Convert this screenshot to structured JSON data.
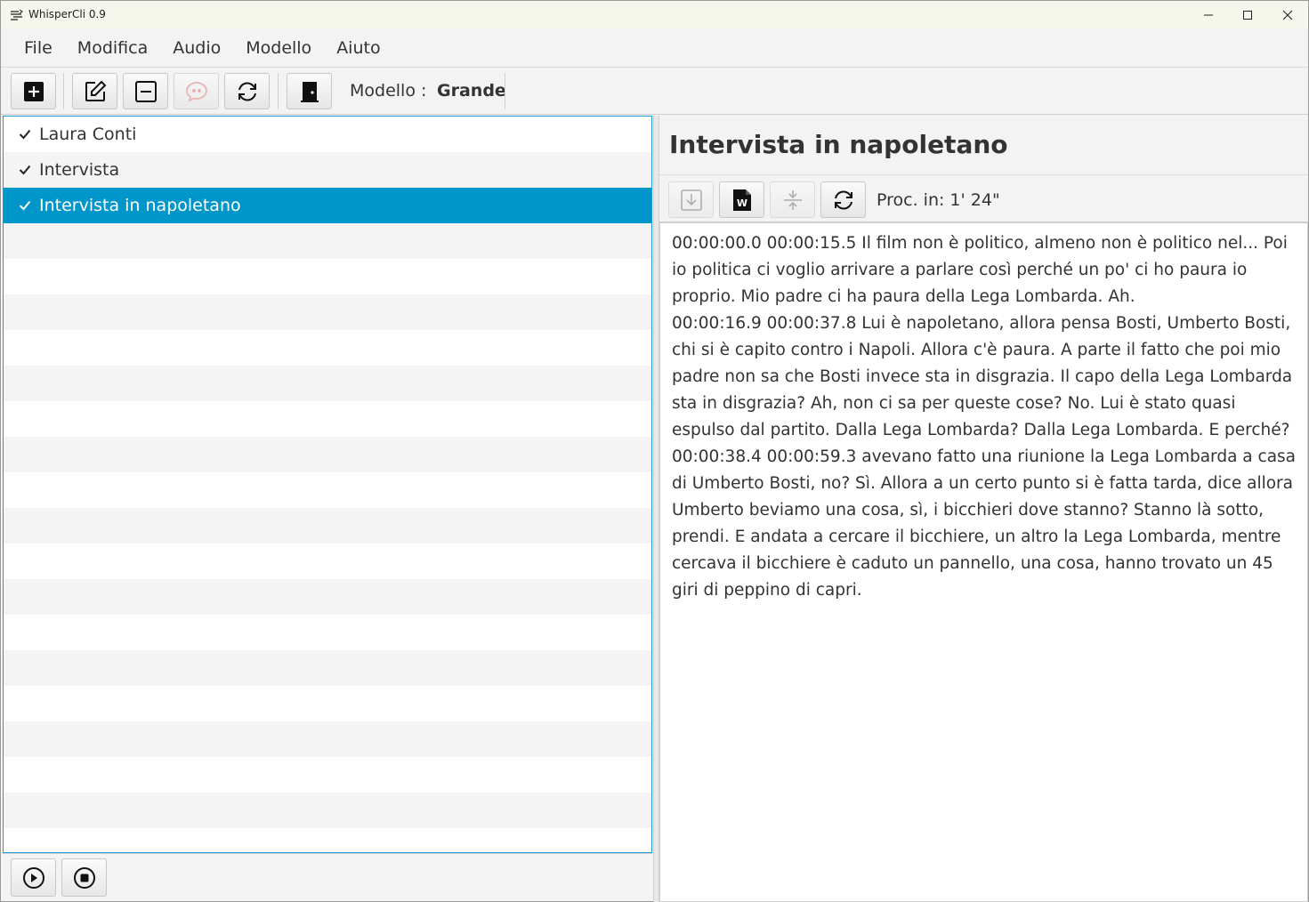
{
  "app": {
    "title": "WhisperCli 0.9"
  },
  "window_controls": [
    "minimize-icon",
    "maximize-icon",
    "close-icon"
  ],
  "menu": [
    {
      "label": "File"
    },
    {
      "label": "Modifica"
    },
    {
      "label": "Audio"
    },
    {
      "label": "Modello"
    },
    {
      "label": "Aiuto"
    }
  ],
  "toolbar": {
    "buttons": [
      "add-icon",
      "edit-icon",
      "remove-icon",
      "speech-icon",
      "refresh-icon",
      "exit-door-icon"
    ],
    "model_label": "Modello :",
    "model_value": "Grande"
  },
  "list": {
    "items": [
      {
        "label": "Laura Conti",
        "checked": true,
        "selected": false
      },
      {
        "label": "Intervista",
        "checked": true,
        "selected": false
      },
      {
        "label": "Intervista in napoletano",
        "checked": true,
        "selected": true
      }
    ]
  },
  "player": {
    "buttons": [
      "play-icon",
      "stop-icon"
    ]
  },
  "detail": {
    "title": "Intervista in napoletano",
    "buttons": [
      "download-icon",
      "word-doc-icon",
      "compress-icon",
      "refresh-icon"
    ],
    "proc_label": "Proc. in: 1' 24\"",
    "transcript": "00:00:00.0 00:00:15.5 Il film non è politico, almeno non è politico nel... Poi io politica ci voglio arrivare a parlare così perché un po' ci ho paura io proprio. Mio padre ci ha paura della Lega Lombarda. Ah.\n00:00:16.9 00:00:37.8 Lui è napoletano, allora pensa Bosti, Umberto Bosti, chi si è capito contro i Napoli. Allora c'è paura. A parte il fatto che poi mio padre non sa che Bosti invece sta in disgrazia. Il capo della Lega Lombarda sta in disgrazia? Ah, non ci sa per queste cose? No. Lui è stato quasi espulso dal partito. Dalla Lega Lombarda? Dalla Lega Lombarda. E perché?\n00:00:38.4 00:00:59.3 avevano fatto una riunione la Lega Lombarda a casa di Umberto Bosti, no? Sì. Allora a un certo punto si è fatta tarda, dice allora Umberto beviamo una cosa, sì, i bicchieri dove stanno? Stanno là sotto, prendi. E andata a cercare il bicchiere, un altro la Lega Lombarda, mentre cercava il bicchiere è caduto un pannello, una cosa, hanno trovato un 45 giri di peppino di capri."
  },
  "colors": {
    "selection": "#0096c9",
    "focus_border": "#1e9bd1"
  }
}
